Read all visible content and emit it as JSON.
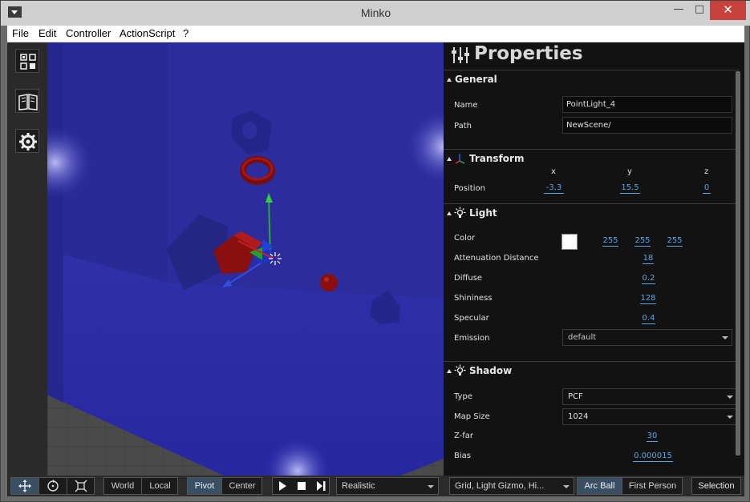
{
  "window": {
    "title": "Minko",
    "minimize": "—",
    "maximize": "□",
    "close": "✕"
  },
  "menu": [
    "File",
    "Edit",
    "Controller",
    "ActionScript",
    "?"
  ],
  "left_toolbar": {
    "icons": [
      "scene-graph-icon",
      "library-book-icon",
      "settings-gear-icon"
    ]
  },
  "properties": {
    "title": "Properties",
    "general": {
      "title": "General",
      "name_label": "Name",
      "name_value": "PointLight_4",
      "path_label": "Path",
      "path_value": "NewScene/"
    },
    "transform": {
      "title": "Transform",
      "axes": [
        "x",
        "y",
        "z"
      ],
      "position_label": "Position",
      "position": [
        "-3.3",
        "15.5",
        "0"
      ]
    },
    "light": {
      "title": "Light",
      "color_label": "Color",
      "color_swatch": "#ffffff",
      "color_rgb": [
        "255",
        "255",
        "255"
      ],
      "attenuation_label": "Attenuation Distance",
      "attenuation": "18",
      "diffuse_label": "Diffuse",
      "diffuse": "0.2",
      "shininess_label": "Shininess",
      "shininess": "128",
      "specular_label": "Specular",
      "specular": "0.4",
      "emission_label": "Emission",
      "emission": "default"
    },
    "shadow": {
      "title": "Shadow",
      "type_label": "Type",
      "type": "PCF",
      "mapsize_label": "Map Size",
      "mapsize": "1024",
      "zfar_label": "Z-far",
      "zfar": "30",
      "bias_label": "Bias",
      "bias": "0.000015"
    }
  },
  "bottom_toolbar": {
    "transform_tools": [
      "move-icon",
      "rotate-icon",
      "scale-icon"
    ],
    "space": {
      "world": "World",
      "local": "Local"
    },
    "pivot": {
      "pivot": "Pivot",
      "center": "Center"
    },
    "playback": [
      "play-icon",
      "stop-icon",
      "step-icon"
    ],
    "render_mode": "Realistic",
    "display_options": "Grid, Light Gizmo, Hi...",
    "camera": {
      "arcball": "Arc Ball",
      "firstperson": "First Person"
    },
    "selection": "Selection"
  },
  "colors": {
    "accent_blue": "#58a6ea",
    "scene_blue": "#2a2a9a",
    "active_button": "#3a4f63"
  }
}
